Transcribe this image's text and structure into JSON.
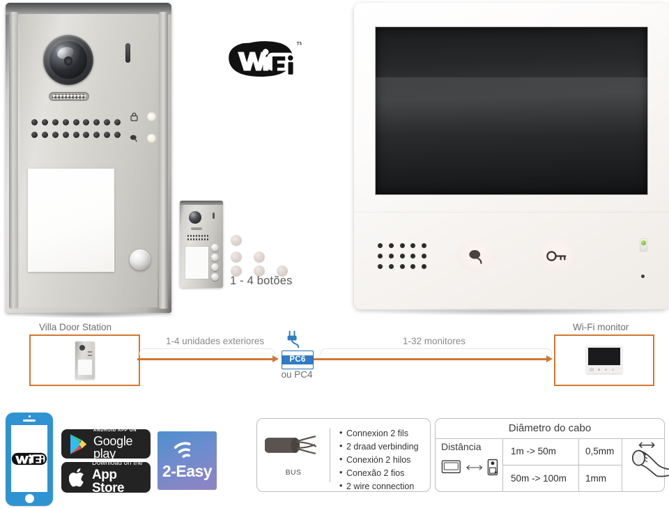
{
  "wifi_logo": {
    "text": "Wi Fi",
    "tm": "TM"
  },
  "door_station": {
    "name": "villa-door-station",
    "indicators": [
      "lock-icon",
      "talk-icon"
    ]
  },
  "small_station": {
    "buttons_label": "1 - 4 botões",
    "button_dot_count": 6
  },
  "monitor": {
    "buttons": [
      {
        "name": "talk-button",
        "icon": "talk-icon"
      },
      {
        "name": "unlock-button",
        "icon": "key-icon"
      }
    ],
    "led": "power-led",
    "mic": "microphone"
  },
  "topology": {
    "left_label": "Villa Door Station",
    "right_label": "Wi-Fi monitor",
    "span_left": "1-4 unidades exteriores",
    "span_right": "1-32 monitores",
    "adapter": "PC6",
    "adapter_alt": "ou PC4",
    "line_color": "#cf7733",
    "adapter_color": "#2f7cc4"
  },
  "apps": {
    "phone_badge": "Wi Fi",
    "google": {
      "top": "ANDROID APP ON",
      "name": "Google play"
    },
    "apple": {
      "top": "Download on the",
      "name": "App Store"
    },
    "brand": "2-Easy"
  },
  "bus_panel": {
    "icon_label": "BUS",
    "items": [
      "Connexion 2 fils",
      "2 draad verbinding",
      "Conexión 2 hilos",
      "Conexão 2 fios",
      "2 wire connection"
    ]
  },
  "cable_table": {
    "title": "Diâmetro do cabo",
    "distance_label": "Distância",
    "rows": [
      {
        "range": "1m -> 50m",
        "diameter": "0,5mm"
      },
      {
        "range": "50m -> 100m",
        "diameter": "1mm"
      }
    ]
  }
}
